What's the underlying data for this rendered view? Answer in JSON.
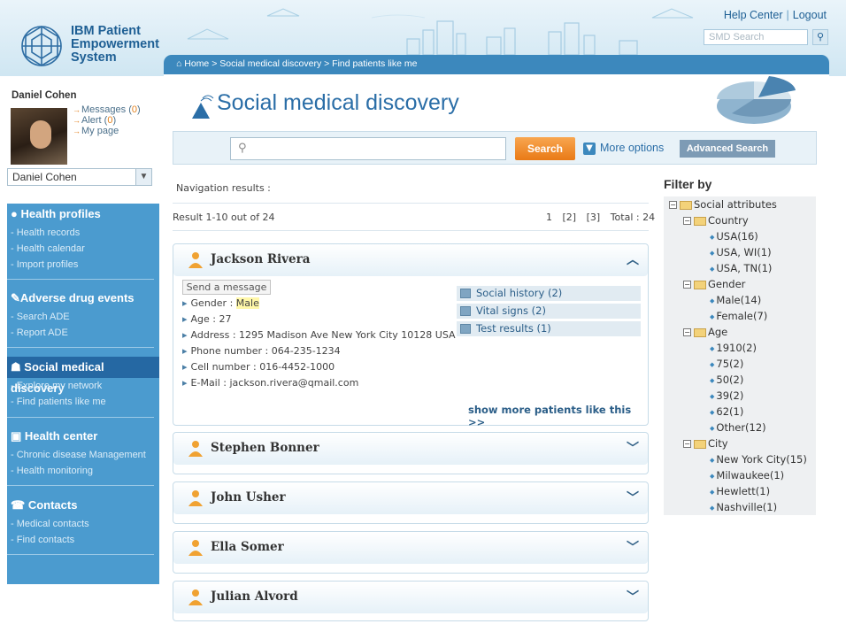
{
  "app": {
    "logo_lines": [
      "IBM Patient",
      "Empowerment",
      "System"
    ],
    "help_center": "Help Center",
    "logout": "Logout",
    "smd_search_placeholder": "SMD Search"
  },
  "breadcrumb": "Home > Social medical discovery > Find patients like me",
  "user": {
    "name": "Daniel Cohen",
    "messages_label": "Messages (",
    "messages_count": "0",
    "alert_label": "Alert (",
    "alert_count": "0",
    "close_paren": ")",
    "my_page": "My page",
    "selector_value": "Daniel Cohen"
  },
  "sidebar": {
    "sections": [
      {
        "title": "Health profiles",
        "items": [
          "- Health records",
          "- Health calendar",
          "- Import profiles"
        ]
      },
      {
        "title": "Adverse drug events",
        "items": [
          "- Search ADE",
          "- Report ADE"
        ]
      },
      {
        "title": "Social medical discovery",
        "items": [
          "- Explore my network",
          "- Find patients like me"
        ]
      },
      {
        "title": "Health center",
        "items": [
          "- Chronic disease Management",
          "- Health monitoring"
        ]
      },
      {
        "title": "Contacts",
        "items": [
          "- Medical contacts",
          "- Find contacts"
        ]
      }
    ]
  },
  "main": {
    "title": "Social medical discovery",
    "search_button": "Search",
    "more_options": "More options",
    "advanced_search": "Advanced Search",
    "navigation_results": "Navigation results :",
    "result_count": "Result 1-10 out of 24",
    "pages": [
      "1",
      "[2]",
      "[3]"
    ],
    "total": "Total : 24"
  },
  "expanded_patient": {
    "name": "Jackson Rivera",
    "send_message": "Send a message",
    "gender_label": "Gender : ",
    "gender_value": "Male",
    "age": "Age : 27",
    "address": "Address : 1295 Madison Ave New York City 10128 USA",
    "phone": "Phone number : 064-235-1234",
    "cell": "Cell number : 016-4452-1000",
    "email": "E-Mail : jackson.rivera@qmail.com",
    "links": [
      "Social history (2)",
      "Vital signs (2)",
      "Test results (1)"
    ],
    "show_more": "show more patients like this >>"
  },
  "collapsed_patients": [
    "Stephen Bonner",
    "John Usher",
    "Ella Somer",
    "Julian Alvord"
  ],
  "filter": {
    "title": "Filter by",
    "root": "Social attributes",
    "groups": [
      {
        "name": "Country",
        "items": [
          "USA(16)",
          "USA, WI(1)",
          "USA, TN(1)"
        ]
      },
      {
        "name": "Gender",
        "items": [
          "Male(14)",
          "Female(7)"
        ]
      },
      {
        "name": "Age",
        "items": [
          "1910(2)",
          "75(2)",
          "50(2)",
          "39(2)",
          "62(1)",
          "Other(12)"
        ]
      },
      {
        "name": "City",
        "items": [
          "New York City(15)",
          "Milwaukee(1)",
          "Hewlett(1)",
          "Nashville(1)"
        ]
      }
    ]
  },
  "icons": [
    "logo-mark-icon",
    "home-icon",
    "search-icon",
    "pie-chart-icon",
    "person-icon",
    "folder-icon",
    "chevron-up-icon",
    "chevron-down-icon"
  ],
  "colors": {
    "accent": "#3c88bd",
    "sidebar": "#4b9bcf",
    "search_button": "#e97a16",
    "title": "#2b6ea7"
  }
}
